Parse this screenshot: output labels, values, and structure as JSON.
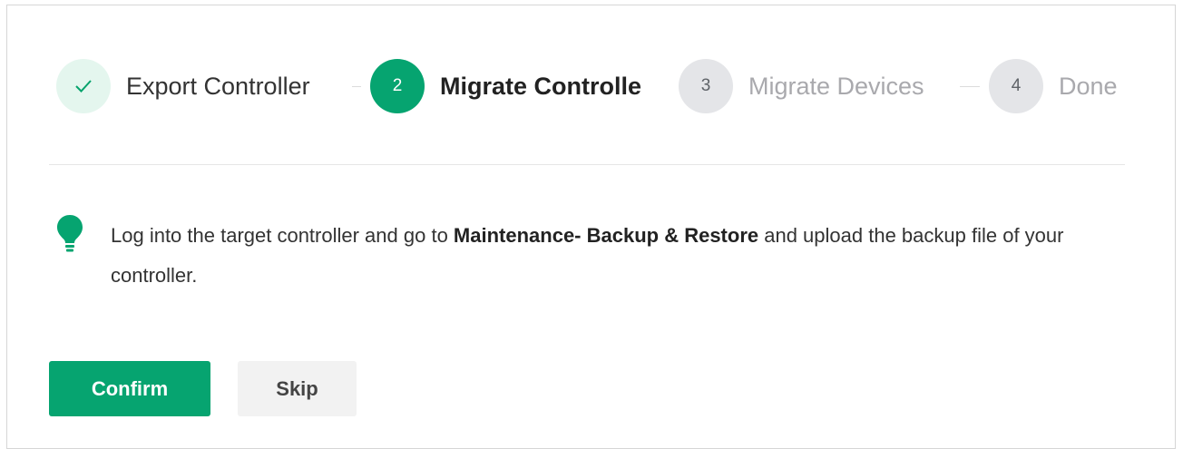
{
  "steps": [
    {
      "number": "",
      "label": "Export Controller",
      "state": "done",
      "icon": "check-icon"
    },
    {
      "number": "2",
      "label": "Migrate Controlle",
      "state": "active"
    },
    {
      "number": "3",
      "label": "Migrate Devices",
      "state": "pending"
    },
    {
      "number": "4",
      "label": "Done",
      "state": "pending"
    }
  ],
  "tip": {
    "icon": "lightbulb-icon",
    "text_before": "Log into the target controller and go to ",
    "text_bold": "Maintenance- Backup & Restore",
    "text_after": " and upload the backup file of your controller."
  },
  "buttons": {
    "confirm_label": "Confirm",
    "skip_label": "Skip"
  },
  "colors": {
    "accent": "#06a470",
    "done_bg": "#e4f6ee",
    "pending_bg": "#e4e5e8"
  }
}
